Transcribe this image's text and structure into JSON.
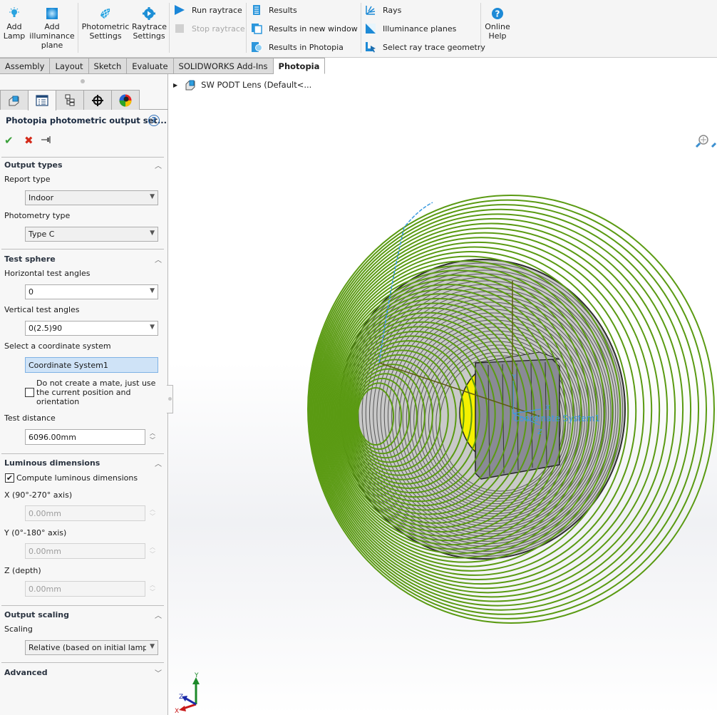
{
  "ribbon": {
    "add_lamp": "Add Lamp",
    "add_illuminance_plane": "Add illuminance plane",
    "photometric_settings": "Photometric Settings",
    "raytrace_settings": "Raytrace Settings",
    "run_raytrace": "Run raytrace",
    "stop_raytrace": "Stop raytrace",
    "results": "Results",
    "results_new_window": "Results in new window",
    "results_photopia": "Results in Photopia",
    "rays": "Rays",
    "illuminance_planes": "Illuminance planes",
    "select_geometry": "Select ray trace geometry",
    "online_help": "Online Help"
  },
  "tabs": [
    {
      "label": "Assembly"
    },
    {
      "label": "Layout"
    },
    {
      "label": "Sketch"
    },
    {
      "label": "Evaluate"
    },
    {
      "label": "SOLIDWORKS Add-Ins"
    },
    {
      "label": "Photopia",
      "active": true
    }
  ],
  "panel": {
    "title": "Photopia photometric output set...",
    "help": "?",
    "ok": "✔",
    "cancel": "✖",
    "pin": "⊣",
    "output_types": {
      "header": "Output types",
      "report_type_label": "Report type",
      "report_type_value": "Indoor",
      "photometry_type_label": "Photometry type",
      "photometry_type_value": "Type C"
    },
    "test_sphere": {
      "header": "Test sphere",
      "horizontal_label": "Horizontal test angles",
      "horizontal_value": "0",
      "vertical_label": "Vertical test angles",
      "vertical_value": "0(2.5)90",
      "coord_label": "Select a coordinate system",
      "coord_value": "Coordinate System1",
      "no_mate_label": "Do not create a mate, just use the current position and orientation",
      "no_mate_checked": false,
      "distance_label": "Test distance",
      "distance_value": "6096.00mm"
    },
    "luminous": {
      "header": "Luminous dimensions",
      "compute_label": "Compute luminous dimensions",
      "compute_checked": true,
      "x_label": "X (90°-270° axis)",
      "x_value": "0.00mm",
      "y_label": "Y (0°-180° axis)",
      "y_value": "0.00mm",
      "z_label": "Z (depth)",
      "z_value": "0.00mm"
    },
    "output_scaling": {
      "header": "Output scaling",
      "scaling_label": "Scaling",
      "scaling_value": "Relative (based on initial lamp lu"
    },
    "advanced": {
      "header": "Advanced"
    }
  },
  "viewport": {
    "tree_item": "SW PODT Lens  (Default<...",
    "coord_system_label": "Coordinate System1",
    "axis_x": "X",
    "axis_y": "Y",
    "axis_z": "Z",
    "colors": {
      "rings": "#5a9a12",
      "body": "#4a4a4a",
      "lamp": "#f5f000",
      "coord": "#3c9be0"
    }
  }
}
